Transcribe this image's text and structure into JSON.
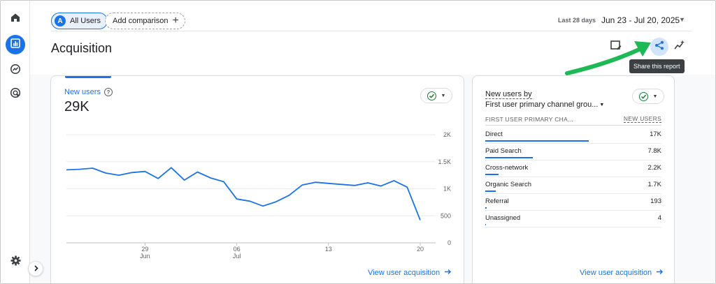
{
  "filters": {
    "all_users_label": "All Users",
    "all_users_avatar": "A",
    "add_comparison_label": "Add comparison"
  },
  "date": {
    "preset_label": "Last 28 days",
    "range": "Jun 23 - Jul 20, 2025"
  },
  "page": {
    "title": "Acquisition",
    "share_tooltip": "Share this report"
  },
  "left_card": {
    "metric_label": "New users",
    "metric_value": "29K",
    "link_label": "View user acquisition"
  },
  "right_card": {
    "title_line1": "New users by",
    "title_line2": "First user primary channel grou...",
    "column_left": "FIRST USER PRIMARY CHA...",
    "column_right": "NEW USERS",
    "rows": [
      {
        "channel": "Direct",
        "value_label": "17K",
        "value": 17000
      },
      {
        "channel": "Paid Search",
        "value_label": "7.8K",
        "value": 7800
      },
      {
        "channel": "Cross-network",
        "value_label": "2.2K",
        "value": 2200
      },
      {
        "channel": "Organic Search",
        "value_label": "1.7K",
        "value": 1700
      },
      {
        "channel": "Referral",
        "value_label": "193",
        "value": 193
      },
      {
        "channel": "Unassigned",
        "value_label": "4",
        "value": 4
      }
    ],
    "link_label": "View user acquisition"
  },
  "colors": {
    "accent": "#1a73e8",
    "check": "#188038",
    "annotation_arrow": "#1db954"
  },
  "icons": {
    "rail": [
      "home-icon",
      "reports-icon",
      "explore-icon",
      "advertising-icon",
      "settings-icon"
    ],
    "toolbar": [
      "customize-report-icon",
      "share-icon",
      "insights-icon"
    ]
  },
  "chart_data": {
    "type": "line",
    "title": "",
    "xlabel": "",
    "ylabel": "",
    "ylim": [
      0,
      2000
    ],
    "yticks": [
      "2K",
      "1.5K",
      "1K",
      "500",
      "0"
    ],
    "ytick_values": [
      2000,
      1500,
      1000,
      500,
      0
    ],
    "xtick_labels": [
      {
        "day": "29",
        "month": "Jun",
        "index": 6
      },
      {
        "day": "06",
        "month": "Jul",
        "index": 13
      },
      {
        "day": "13",
        "month": "",
        "index": 20
      },
      {
        "day": "20",
        "month": "",
        "index": 27
      }
    ],
    "x": [
      "Jun 23",
      "Jun 24",
      "Jun 25",
      "Jun 26",
      "Jun 27",
      "Jun 28",
      "Jun 29",
      "Jun 30",
      "Jul 01",
      "Jul 02",
      "Jul 03",
      "Jul 04",
      "Jul 05",
      "Jul 06",
      "Jul 07",
      "Jul 08",
      "Jul 09",
      "Jul 10",
      "Jul 11",
      "Jul 12",
      "Jul 13",
      "Jul 14",
      "Jul 15",
      "Jul 16",
      "Jul 17",
      "Jul 18",
      "Jul 19",
      "Jul 20"
    ],
    "series": [
      {
        "values": [
          1350,
          1360,
          1380,
          1290,
          1250,
          1300,
          1320,
          1190,
          1390,
          1160,
          1310,
          1200,
          1130,
          810,
          770,
          680,
          760,
          880,
          1070,
          1120,
          1100,
          1080,
          1060,
          1110,
          1050,
          1150,
          1030,
          420
        ]
      }
    ]
  }
}
